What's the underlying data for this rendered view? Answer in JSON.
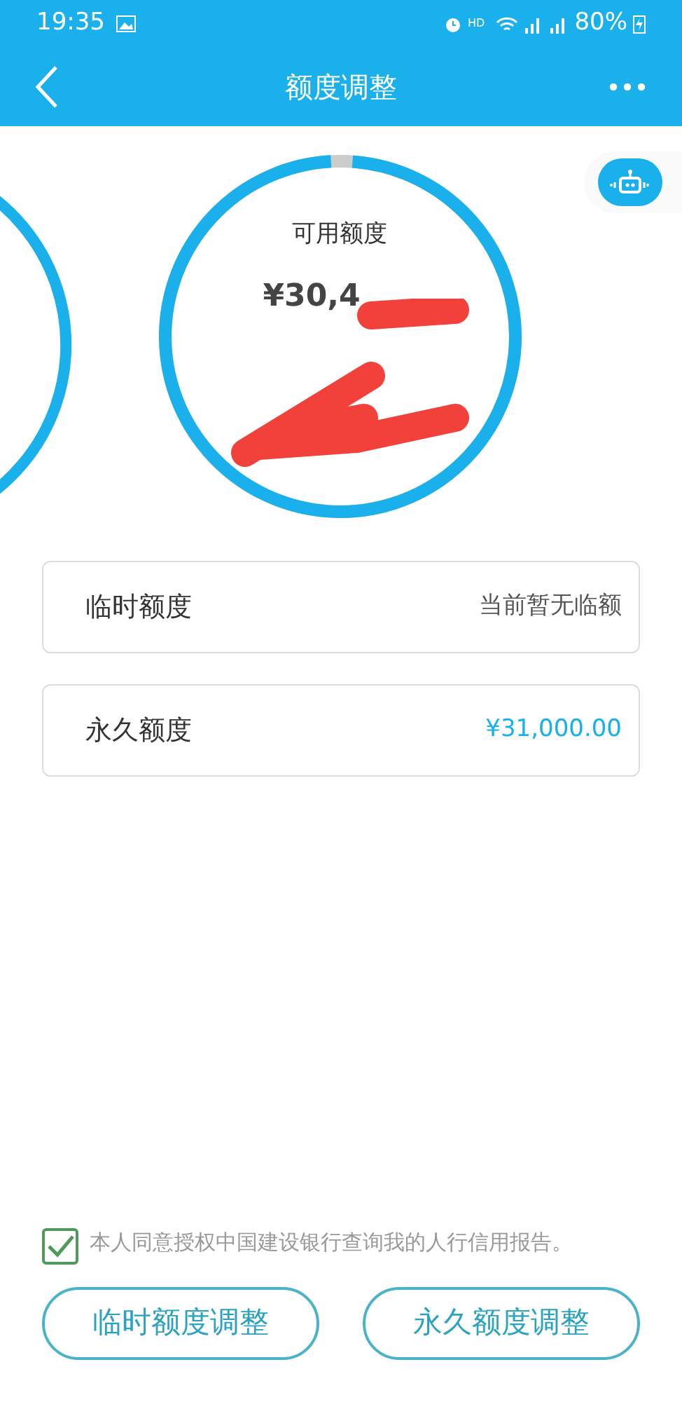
{
  "status_bar": {
    "time": "19:35",
    "hd": "HD",
    "battery": "80%"
  },
  "header": {
    "title": "额度调整"
  },
  "gauge": {
    "label": "可用额度",
    "amount": "¥30,4",
    "level": 0.98
  },
  "items": [
    {
      "label": "临时额度",
      "value": "当前暂无临额",
      "highlight": false
    },
    {
      "label": "永久额度",
      "value": "¥31,000.00",
      "highlight": true
    }
  ],
  "consent": {
    "checked": true,
    "text": "本人同意授权中国建设银行查询我的人行信用报告。"
  },
  "buttons": [
    "临时额度调整",
    "永久额度调整"
  ]
}
